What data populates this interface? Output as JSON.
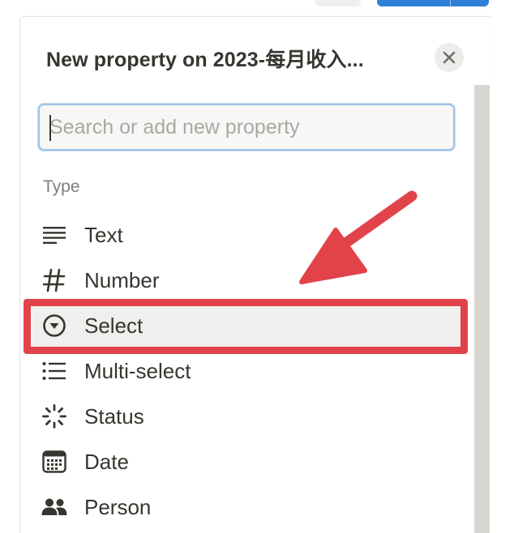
{
  "panel": {
    "title": "New property on 2023-每月收入...",
    "close_icon": "close-icon"
  },
  "search": {
    "value": "",
    "placeholder": "Search or add new property"
  },
  "section": {
    "type_label": "Type"
  },
  "types": [
    {
      "label": "Text",
      "icon": "text-lines-icon"
    },
    {
      "label": "Number",
      "icon": "hash-icon"
    },
    {
      "label": "Select",
      "icon": "select-circle-icon",
      "selected": true
    },
    {
      "label": "Multi-select",
      "icon": "bulleted-list-icon"
    },
    {
      "label": "Status",
      "icon": "status-spinner-icon"
    },
    {
      "label": "Date",
      "icon": "calendar-icon"
    },
    {
      "label": "Person",
      "icon": "people-icon"
    }
  ],
  "annotation": {
    "highlight_color": "#e2434b",
    "arrow_color": "#e2434b"
  }
}
